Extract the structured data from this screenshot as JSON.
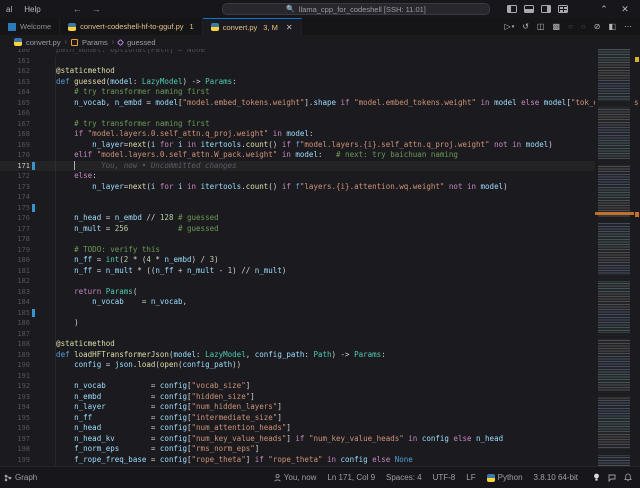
{
  "colors": {
    "accent": "#0078d4",
    "git_modified": "#e2c08d",
    "editor_bg": "#1b1b1f",
    "chrome_bg": "#17171b",
    "change_bar": "#3794cc",
    "ruler_modified": "#c86e28",
    "ruler_search": "#d8b12c"
  },
  "title_bar": {
    "menu_items": [
      "al",
      "Help"
    ],
    "back_icon": "←",
    "forward_icon": "→",
    "command_center": "llama_cpp_for_codeshell [SSH: 11.01]",
    "chevron": "⌃",
    "close": "✕"
  },
  "tabs": [
    {
      "label": "Welcome",
      "active": false
    },
    {
      "label": "convert-codeshell-hf-to-gguf.py",
      "badge": "1",
      "active": false
    },
    {
      "label": "convert.py",
      "badge": "3, M",
      "close": "✕",
      "active": true
    }
  ],
  "editor_actions": {
    "more": "⋯"
  },
  "breadcrumb": {
    "items": [
      "convert.py",
      "Params",
      "guessed"
    ],
    "separator": "›"
  },
  "editor": {
    "lines": [
      {
        "n": 160,
        "tk": [
          [
            "dim",
            "    path_model: Optional[Path] = None"
          ]
        ]
      },
      {
        "n": 161,
        "tk": []
      },
      {
        "n": 162,
        "tk": [
          [
            "f",
            "    @staticmethod"
          ]
        ]
      },
      {
        "n": 163,
        "tk": [
          [
            "k",
            "    def "
          ],
          [
            "f",
            "guessed"
          ],
          [
            "o",
            "("
          ],
          [
            "v",
            "model"
          ],
          [
            "o",
            ": "
          ],
          [
            "t",
            "LazyModel"
          ],
          [
            "o",
            ") -> "
          ],
          [
            "t",
            "Params"
          ],
          [
            "o",
            ":"
          ]
        ]
      },
      {
        "n": 164,
        "tk": [
          [
            "m",
            "        # try transformer naming first"
          ]
        ]
      },
      {
        "n": 165,
        "tk": [
          [
            "v",
            "        n_vocab"
          ],
          [
            "o",
            ", "
          ],
          [
            "v",
            "n_embd"
          ],
          [
            "o",
            " = "
          ],
          [
            "v",
            "model"
          ],
          [
            "o",
            "["
          ],
          [
            "s",
            "\"model.embed_tokens.weight\""
          ],
          [
            "o",
            "]."
          ],
          [
            "v",
            "shape"
          ],
          [
            "c",
            " if "
          ],
          [
            "s",
            "\"model.embed_tokens.weight\""
          ],
          [
            "c",
            " in "
          ],
          [
            "v",
            "model"
          ],
          [
            "c",
            " else "
          ],
          [
            "v",
            "model"
          ],
          [
            "o",
            "["
          ],
          [
            "s",
            "\"tok_embeddings.weight\""
          ],
          [
            "o",
            "]."
          ],
          [
            "v",
            "shape"
          ]
        ]
      },
      {
        "n": 166,
        "tk": []
      },
      {
        "n": 167,
        "tk": [
          [
            "m",
            "        # try transformer naming first"
          ]
        ]
      },
      {
        "n": 168,
        "tk": [
          [
            "c",
            "        if "
          ],
          [
            "s",
            "\"model.layers.0.self_attn.q_proj.weight\""
          ],
          [
            "c",
            " in "
          ],
          [
            "v",
            "model"
          ],
          [
            "o",
            ":"
          ]
        ]
      },
      {
        "n": 169,
        "tk": [
          [
            "v",
            "            n_layer"
          ],
          [
            "o",
            "="
          ],
          [
            "f",
            "next"
          ],
          [
            "o",
            "("
          ],
          [
            "v",
            "i"
          ],
          [
            "c",
            " for "
          ],
          [
            "v",
            "i"
          ],
          [
            "c",
            " in "
          ],
          [
            "v",
            "itertools"
          ],
          [
            "o",
            "."
          ],
          [
            "f",
            "count"
          ],
          [
            "o",
            "() "
          ],
          [
            "c",
            "if "
          ],
          [
            "k",
            "f"
          ],
          [
            "s",
            "\"model.layers.{i}.self_attn.q_proj.weight\""
          ],
          [
            "c",
            " not in "
          ],
          [
            "v",
            "model"
          ],
          [
            "o",
            ")"
          ]
        ]
      },
      {
        "n": 170,
        "tk": [
          [
            "c",
            "        elif "
          ],
          [
            "s",
            "\"model.layers.0.self_attn.W_pack.weight\""
          ],
          [
            "c",
            " in "
          ],
          [
            "v",
            "model"
          ],
          [
            "o",
            ":   "
          ],
          [
            "m",
            "# next: try baichuan naming"
          ]
        ]
      },
      {
        "n": 171,
        "tk": [],
        "cur": true,
        "chg": true,
        "cursor_col": 8,
        "blame": "You, now • Uncommitted changes"
      },
      {
        "n": 172,
        "tk": [
          [
            "c",
            "        else"
          ],
          [
            "o",
            ":"
          ]
        ]
      },
      {
        "n": 173,
        "tk": [
          [
            "v",
            "            n_layer"
          ],
          [
            "o",
            "="
          ],
          [
            "f",
            "next"
          ],
          [
            "o",
            "("
          ],
          [
            "v",
            "i"
          ],
          [
            "c",
            " for "
          ],
          [
            "v",
            "i"
          ],
          [
            "c",
            " in "
          ],
          [
            "v",
            "itertools"
          ],
          [
            "o",
            "."
          ],
          [
            "f",
            "count"
          ],
          [
            "o",
            "() "
          ],
          [
            "c",
            "if "
          ],
          [
            "k",
            "f"
          ],
          [
            "s",
            "\"layers.{i}.attention.wq.weight\""
          ],
          [
            "c",
            " not in "
          ],
          [
            "v",
            "model"
          ],
          [
            "o",
            ")"
          ]
        ]
      },
      {
        "n": 174,
        "tk": []
      },
      {
        "n": 175,
        "tk": [],
        "chg": true
      },
      {
        "n": 176,
        "tk": [
          [
            "v",
            "        n_head"
          ],
          [
            "o",
            " = "
          ],
          [
            "v",
            "n_embd"
          ],
          [
            "o",
            " // "
          ],
          [
            "n",
            "128"
          ],
          [
            "m",
            " # guessed"
          ]
        ]
      },
      {
        "n": 177,
        "tk": [
          [
            "v",
            "        n_mult"
          ],
          [
            "o",
            " = "
          ],
          [
            "n",
            "256"
          ],
          [
            "m",
            "           # guessed"
          ]
        ]
      },
      {
        "n": 178,
        "tk": []
      },
      {
        "n": 179,
        "tk": [
          [
            "m",
            "        # TODO: verify this"
          ]
        ]
      },
      {
        "n": 180,
        "tk": [
          [
            "v",
            "        n_ff"
          ],
          [
            "o",
            " = "
          ],
          [
            "t",
            "int"
          ],
          [
            "o",
            "("
          ],
          [
            "n",
            "2"
          ],
          [
            "o",
            " * ("
          ],
          [
            "n",
            "4"
          ],
          [
            "o",
            " * "
          ],
          [
            "v",
            "n_embd"
          ],
          [
            "o",
            ") / "
          ],
          [
            "n",
            "3"
          ],
          [
            "o",
            ")"
          ]
        ]
      },
      {
        "n": 181,
        "tk": [
          [
            "v",
            "        n_ff"
          ],
          [
            "o",
            " = "
          ],
          [
            "v",
            "n_mult"
          ],
          [
            "o",
            " * (("
          ],
          [
            "v",
            "n_ff"
          ],
          [
            "o",
            " + "
          ],
          [
            "v",
            "n_mult"
          ],
          [
            "o",
            " - "
          ],
          [
            "n",
            "1"
          ],
          [
            "o",
            ") // "
          ],
          [
            "v",
            "n_mult"
          ],
          [
            "o",
            ")"
          ]
        ]
      },
      {
        "n": 182,
        "tk": []
      },
      {
        "n": 183,
        "tk": [
          [
            "c",
            "        return "
          ],
          [
            "t",
            "Params"
          ],
          [
            "o",
            "("
          ]
        ]
      },
      {
        "n": 184,
        "tk": [
          [
            "v",
            "            n_vocab"
          ],
          [
            "o",
            "    = "
          ],
          [
            "v",
            "n_vocab"
          ],
          [
            "o",
            ","
          ]
        ]
      },
      {
        "n": 185,
        "tk": [],
        "chg": true
      },
      {
        "n": 186,
        "tk": [
          [
            "o",
            "        )"
          ]
        ]
      },
      {
        "n": 187,
        "tk": []
      },
      {
        "n": 188,
        "tk": [
          [
            "f",
            "    @staticmethod"
          ]
        ]
      },
      {
        "n": 189,
        "tk": [
          [
            "k",
            "    def "
          ],
          [
            "f",
            "loadHFTransformerJson"
          ],
          [
            "o",
            "("
          ],
          [
            "v",
            "model"
          ],
          [
            "o",
            ": "
          ],
          [
            "t",
            "LazyModel"
          ],
          [
            "o",
            ", "
          ],
          [
            "v",
            "config_path"
          ],
          [
            "o",
            ": "
          ],
          [
            "t",
            "Path"
          ],
          [
            "o",
            ") -> "
          ],
          [
            "t",
            "Params"
          ],
          [
            "o",
            ":"
          ]
        ]
      },
      {
        "n": 190,
        "tk": [
          [
            "v",
            "        config"
          ],
          [
            "o",
            " = "
          ],
          [
            "v",
            "json"
          ],
          [
            "o",
            "."
          ],
          [
            "f",
            "load"
          ],
          [
            "o",
            "("
          ],
          [
            "f",
            "open"
          ],
          [
            "o",
            "("
          ],
          [
            "v",
            "config_path"
          ],
          [
            "o",
            "))"
          ]
        ]
      },
      {
        "n": 191,
        "tk": []
      },
      {
        "n": 192,
        "tk": [
          [
            "v",
            "        n_vocab"
          ],
          [
            "o",
            "          = "
          ],
          [
            "v",
            "config"
          ],
          [
            "o",
            "["
          ],
          [
            "s",
            "\"vocab_size\""
          ],
          [
            "o",
            "]"
          ]
        ]
      },
      {
        "n": 193,
        "tk": [
          [
            "v",
            "        n_embd"
          ],
          [
            "o",
            "           = "
          ],
          [
            "v",
            "config"
          ],
          [
            "o",
            "["
          ],
          [
            "s",
            "\"hidden_size\""
          ],
          [
            "o",
            "]"
          ]
        ]
      },
      {
        "n": 194,
        "tk": [
          [
            "v",
            "        n_layer"
          ],
          [
            "o",
            "          = "
          ],
          [
            "v",
            "config"
          ],
          [
            "o",
            "["
          ],
          [
            "s",
            "\"num_hidden_layers\""
          ],
          [
            "o",
            "]"
          ]
        ]
      },
      {
        "n": 195,
        "tk": [
          [
            "v",
            "        n_ff"
          ],
          [
            "o",
            "             = "
          ],
          [
            "v",
            "config"
          ],
          [
            "o",
            "["
          ],
          [
            "s",
            "\"intermediate_size\""
          ],
          [
            "o",
            "]"
          ]
        ]
      },
      {
        "n": 196,
        "tk": [
          [
            "v",
            "        n_head"
          ],
          [
            "o",
            "           = "
          ],
          [
            "v",
            "config"
          ],
          [
            "o",
            "["
          ],
          [
            "s",
            "\"num_attention_heads\""
          ],
          [
            "o",
            "]"
          ]
        ]
      },
      {
        "n": 197,
        "tk": [
          [
            "v",
            "        n_head_kv"
          ],
          [
            "o",
            "        = "
          ],
          [
            "v",
            "config"
          ],
          [
            "o",
            "["
          ],
          [
            "s",
            "\"num_key_value_heads\""
          ],
          [
            "o",
            "]"
          ],
          [
            "c",
            " if "
          ],
          [
            "s",
            "\"num_key_value_heads\""
          ],
          [
            "c",
            " in "
          ],
          [
            "v",
            "config"
          ],
          [
            "c",
            " else "
          ],
          [
            "v",
            "n_head"
          ]
        ]
      },
      {
        "n": 198,
        "tk": [
          [
            "v",
            "        f_norm_eps"
          ],
          [
            "o",
            "       = "
          ],
          [
            "v",
            "config"
          ],
          [
            "o",
            "["
          ],
          [
            "s",
            "\"rms_norm_eps\""
          ],
          [
            "o",
            "]"
          ]
        ]
      },
      {
        "n": 199,
        "tk": [
          [
            "v",
            "        f_rope_freq_base"
          ],
          [
            "o",
            " = "
          ],
          [
            "v",
            "config"
          ],
          [
            "o",
            "["
          ],
          [
            "s",
            "\"rope_theta\""
          ],
          [
            "o",
            "]"
          ],
          [
            "c",
            " if "
          ],
          [
            "s",
            "\"rope_theta\""
          ],
          [
            "c",
            " in "
          ],
          [
            "v",
            "config"
          ],
          [
            "c",
            " else "
          ],
          [
            "k",
            "None"
          ]
        ]
      }
    ]
  },
  "status_bar": {
    "graph_label": "Graph",
    "blame": "You, now",
    "cursor_position": "Ln 171, Col 9",
    "indentation": "Spaces: 4",
    "encoding": "UTF-8",
    "eol": "LF",
    "language": "Python",
    "python_version": "3.8.10 64-bit"
  }
}
